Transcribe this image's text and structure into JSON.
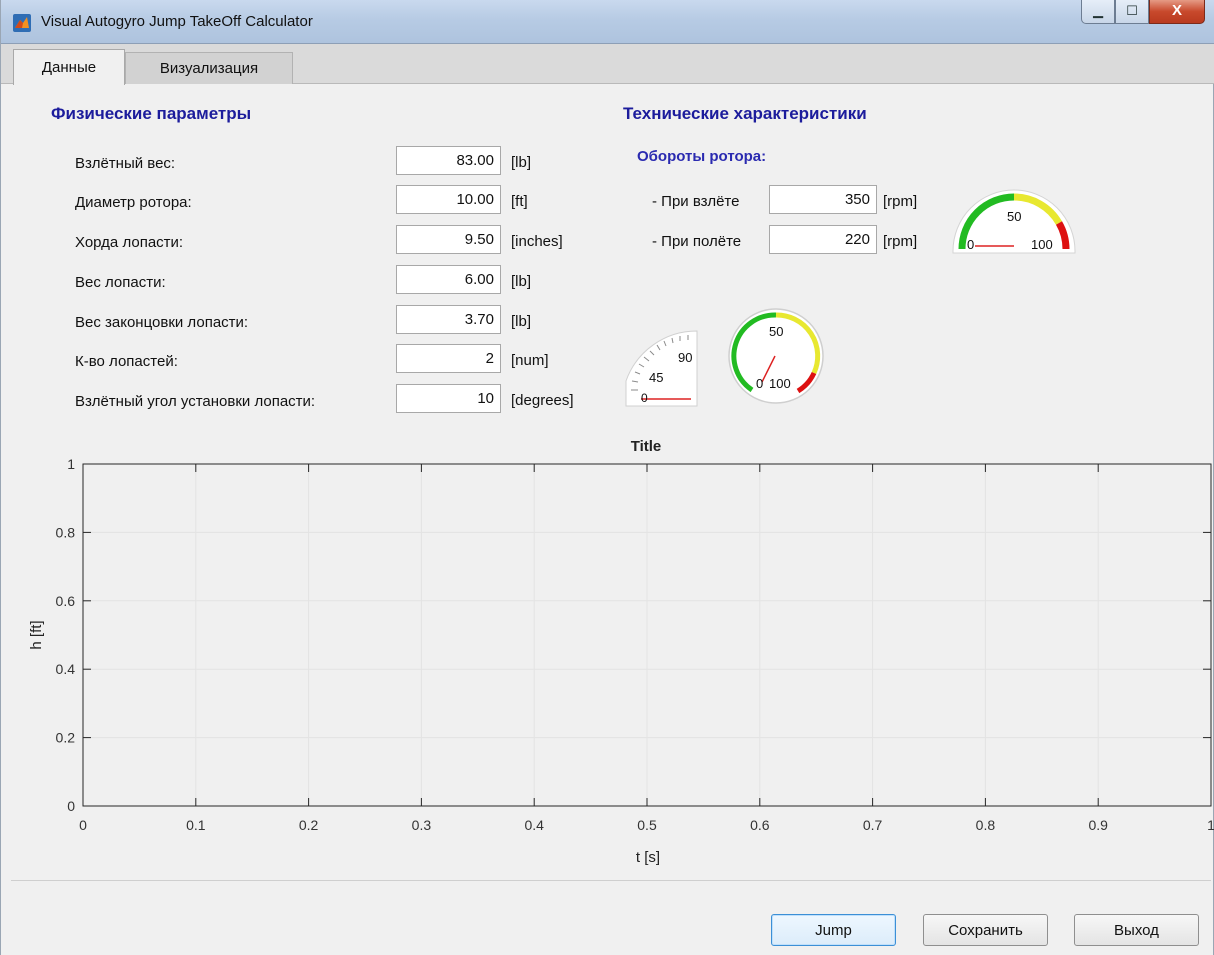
{
  "window": {
    "title": "Visual Autogyro Jump TakeOff Calculator",
    "controls": {
      "minimize": "▁",
      "maximize": "☐",
      "close": "X"
    }
  },
  "tabs": [
    {
      "label": "Данные",
      "active": true
    },
    {
      "label": "Визуализация",
      "active": false
    }
  ],
  "physical": {
    "heading": "Физические параметры",
    "fields": [
      {
        "label": "Взлётный вес:",
        "value": "83.00",
        "unit": "[lb]"
      },
      {
        "label": "Диаметр ротора:",
        "value": "10.00",
        "unit": "[ft]"
      },
      {
        "label": "Хорда лопасти:",
        "value": "9.50",
        "unit": "[inches]"
      },
      {
        "label": "Вес лопасти:",
        "value": "6.00",
        "unit": "[lb]"
      },
      {
        "label": "Вес законцовки лопасти:",
        "value": "3.70",
        "unit": "[lb]"
      },
      {
        "label": "К-во лопастей:",
        "value": "2",
        "unit": "[num]"
      },
      {
        "label": "Взлётный угол установки лопасти:",
        "value": "10",
        "unit": "[degrees]"
      }
    ]
  },
  "technical": {
    "heading": "Технические характеристики",
    "rotor_heading": "Обороты ротора:",
    "fields": [
      {
        "label": "- При взлёте",
        "value": "350",
        "unit": "[rpm]"
      },
      {
        "label": "- При полёте",
        "value": "220",
        "unit": "[rpm]"
      }
    ]
  },
  "gauges": {
    "semi": {
      "min": "0",
      "mid": "50",
      "max": "100",
      "value": 0
    },
    "quarter": {
      "min": "0",
      "mid": "45",
      "max": "90",
      "value": 0
    },
    "circular": {
      "min": "0",
      "mid": "50",
      "max": "100",
      "value": 0.1
    }
  },
  "colors": {
    "green": "#22bb22",
    "yellow": "#e8e830",
    "red": "#dd1111",
    "heading": "#1c1c9c"
  },
  "chart_data": {
    "type": "line",
    "title": "Title",
    "xlabel": "t [s]",
    "ylabel": "h [ft]",
    "xlim": [
      0,
      1
    ],
    "ylim": [
      0,
      1
    ],
    "xticks": [
      "0",
      "0.1",
      "0.2",
      "0.3",
      "0.4",
      "0.5",
      "0.6",
      "0.7",
      "0.8",
      "0.9",
      "1"
    ],
    "yticks": [
      "0",
      "0.2",
      "0.4",
      "0.6",
      "0.8",
      "1"
    ],
    "grid": true,
    "series": []
  },
  "buttons": {
    "jump": "Jump",
    "save": "Сохранить",
    "exit": "Выход"
  }
}
